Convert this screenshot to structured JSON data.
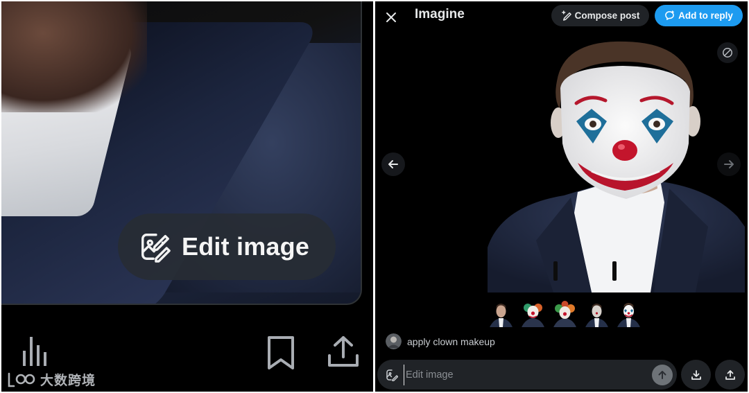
{
  "left": {
    "edit_image_label": "Edit image",
    "icons": [
      "stats-icon",
      "bookmark-icon",
      "share-icon",
      "edit-image-icon"
    ]
  },
  "watermark": {
    "text": "大数跨境",
    "logo_text": "LOO"
  },
  "imagine": {
    "title": "Imagine",
    "compose_post_label": "Compose post",
    "add_to_reply_label": "Add to reply",
    "prompt_text": "apply clown makeup",
    "edit_input_placeholder": "Edit image",
    "thumbnails": [
      "original-portrait",
      "clown-variant-1",
      "clown-variant-2",
      "portrait-variant",
      "joker-makeup-selected"
    ],
    "icons": [
      "close-icon",
      "sparkle-pen-icon",
      "reply-bubble-icon",
      "hide-icon",
      "arrow-left-icon",
      "arrow-right-icon",
      "edit-image-icon",
      "arrow-up-icon",
      "download-icon",
      "upload-icon"
    ]
  },
  "colors": {
    "background": "#000000",
    "accent": "#1d9bf0",
    "pill": "#272c34",
    "input": "#202327",
    "text": "#e7e9ea"
  }
}
